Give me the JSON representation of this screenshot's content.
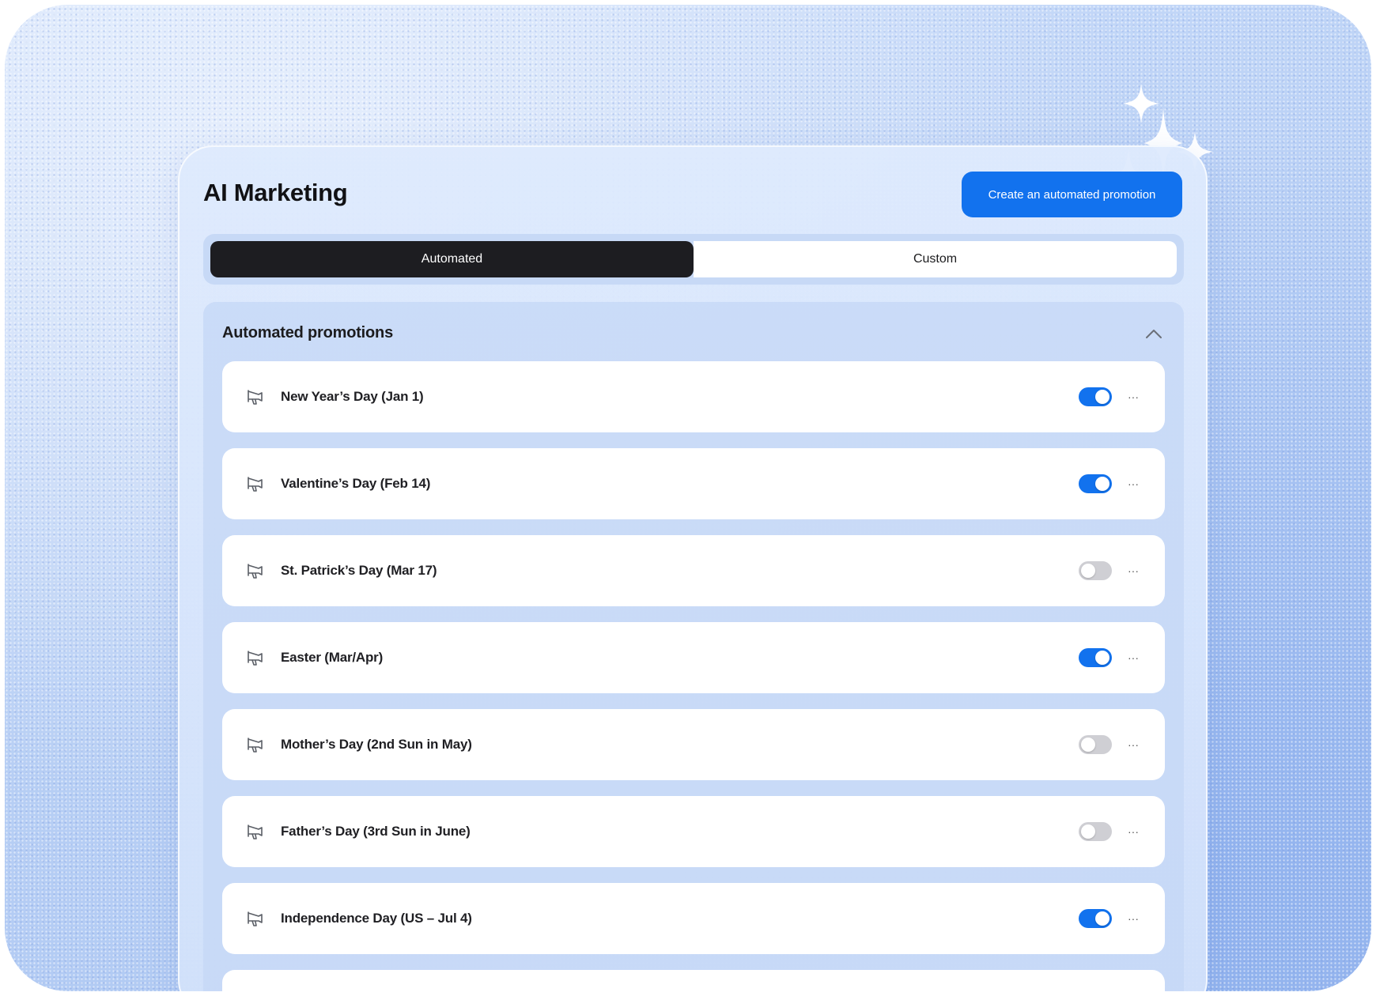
{
  "header": {
    "title": "AI Marketing",
    "create_button": "Create an automated promotion"
  },
  "tabs": [
    {
      "label": "Automated",
      "active": true
    },
    {
      "label": "Custom",
      "active": false
    }
  ],
  "section": {
    "title": "Automated promotions",
    "collapse_icon": "chevron-up-icon",
    "row_icon": "megaphone-icon",
    "more_label": "···"
  },
  "promotions": [
    {
      "label": "New Year’s Day (Jan 1)",
      "enabled": true
    },
    {
      "label": "Valentine’s Day (Feb 14)",
      "enabled": true
    },
    {
      "label": "St. Patrick’s Day (Mar 17)",
      "enabled": false
    },
    {
      "label": "Easter (Mar/Apr)",
      "enabled": true
    },
    {
      "label": "Mother’s Day (2nd Sun in May)",
      "enabled": false
    },
    {
      "label": "Father’s Day (3rd Sun in June)",
      "enabled": false
    },
    {
      "label": "Independence Day (US – Jul 4)",
      "enabled": true
    },
    {
      "label": "",
      "enabled": false
    }
  ],
  "colors": {
    "accent": "#1272ee",
    "active_tab": "#1d1d21",
    "toggle_off": "#cfcfd4"
  }
}
